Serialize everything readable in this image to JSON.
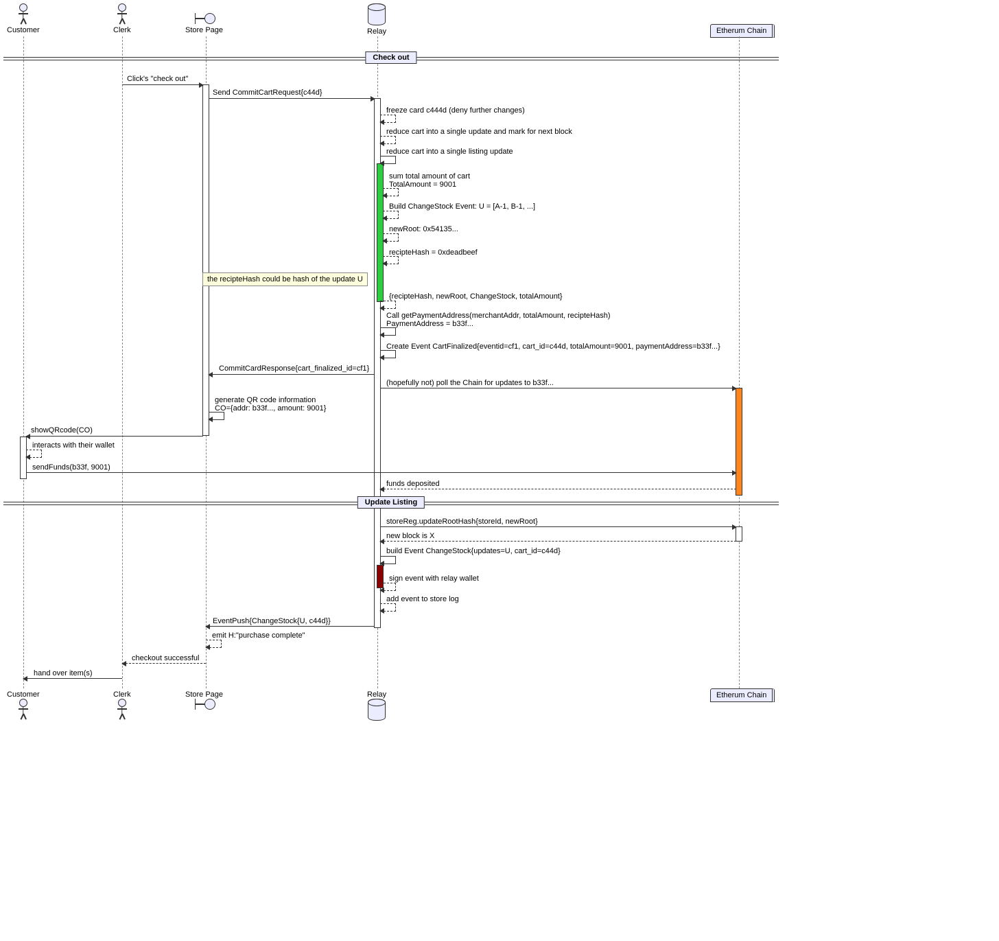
{
  "participants": {
    "customer": "Customer",
    "clerk": "Clerk",
    "storepage": "Store Page",
    "relay": "Relay",
    "chain": "Etherum Chain"
  },
  "dividers": {
    "checkout": "Check out",
    "updatelisting": "Update Listing"
  },
  "messages": {
    "m1": "Click's \"check out\"",
    "m2": "Send CommitCartRequest{c44d}",
    "m3": "freeze card c444d (deny further changes)",
    "m4": "reduce cart into a single update and mark for next block",
    "m5": "reduce cart into a single listing update",
    "m6a": "sum total amount of cart",
    "m6b": "TotalAmount = 9001",
    "m7": "Build ChangeStock Event: U = [A-1, B-1, ...]",
    "m8": "newRoot: 0x54135...",
    "m9": "recipteHash = 0xdeadbeef",
    "m10": "{recipteHash, newRoot, ChangeStock, totalAmount}",
    "m11a": "Call getPaymentAddress(merchantAddr, totalAmount, recipteHash)",
    "m11b": "PaymentAddress = b33f...",
    "m12": "Create Event CartFinalized{eventid=cf1, cart_id=c44d, totalAmount=9001, paymentAddress=b33f...}",
    "m13": "CommitCardResponse{cart_finalized_id=cf1}",
    "m14": "(hopefully not) poll the Chain for updates to b33f...",
    "m15a": "generate QR code information",
    "m15b": "CO={addr: b33f..., amount: 9001}",
    "m16": "showQRcode(CO)",
    "m17": "interacts with their wallet",
    "m18": "sendFunds(b33f, 9001)",
    "m19": "funds deposited",
    "m20": "storeReg.updateRootHash{storeId, newRoot}",
    "m21": "new block is X",
    "m22": "build Event ChangeStock{updates=U, cart_id=c44d}",
    "m23": "sign event with relay wallet",
    "m24": "add event to store log",
    "m25": "EventPush{ChangeStock{U, c44d}}",
    "m26": "emit H:\"purchase complete\"",
    "m27": "checkout successful",
    "m28": "hand over item(s)"
  },
  "notes": {
    "n1": "the recipteHash could be hash of the update U"
  }
}
